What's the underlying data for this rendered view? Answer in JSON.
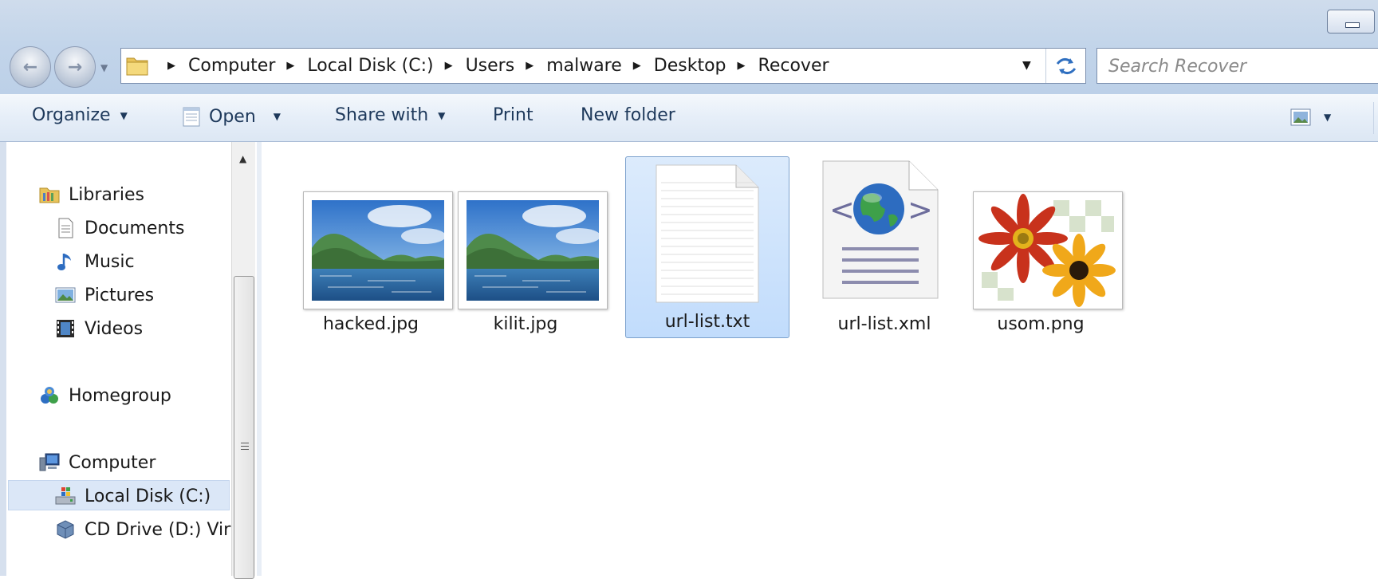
{
  "window": {
    "minimize_icon": "minimize-icon"
  },
  "navigation": {
    "back_icon": "arrow-left-icon",
    "forward_icon": "arrow-right-icon",
    "recent_icon": "chevron-down-icon"
  },
  "address": {
    "breadcrumbs": [
      "Computer",
      "Local Disk (C:)",
      "Users",
      "malware",
      "Desktop",
      "Recover"
    ],
    "folder_icon": "folder-icon",
    "dropdown_icon": "chevron-down-icon",
    "refresh_icon": "refresh-icon"
  },
  "search": {
    "placeholder": "Search Recover"
  },
  "toolbar": {
    "organize_label": "Organize",
    "open_label": "Open",
    "share_label": "Share with",
    "print_label": "Print",
    "new_folder_label": "New folder",
    "view_icon": "view-options-icon"
  },
  "sidebar": {
    "libraries_label": "Libraries",
    "library_items": [
      {
        "label": "Documents",
        "icon": "document-icon"
      },
      {
        "label": "Music",
        "icon": "music-icon"
      },
      {
        "label": "Pictures",
        "icon": "pictures-icon"
      },
      {
        "label": "Videos",
        "icon": "film-icon"
      }
    ],
    "homegroup_label": "Homegroup",
    "computer_label": "Computer",
    "drives": [
      {
        "label": "Local Disk (C:)",
        "icon": "hard-drive-icon",
        "selected": true
      },
      {
        "label": "CD Drive (D:) Virt",
        "icon": "cd-drive-icon",
        "selected": false
      }
    ]
  },
  "files": [
    {
      "name": "hacked.jpg",
      "type": "image",
      "icon": "landscape-thumbnail"
    },
    {
      "name": "kilit.jpg",
      "type": "image",
      "icon": "landscape-thumbnail"
    },
    {
      "name": "url-list.txt",
      "type": "text",
      "icon": "text-file-icon",
      "selected": true
    },
    {
      "name": "url-list.xml",
      "type": "xml",
      "icon": "xml-globe-icon"
    },
    {
      "name": "usom.png",
      "type": "image",
      "icon": "flowers-thumbnail"
    }
  ],
  "colors": {
    "selection": "#c1dcfc",
    "selection_border": "#7da2ce",
    "chrome": "#c3d5ea"
  }
}
